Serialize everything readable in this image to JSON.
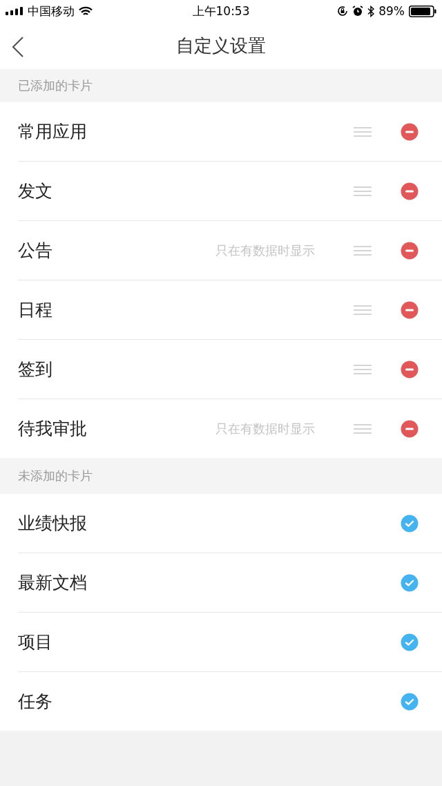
{
  "status_bar": {
    "carrier": "中国移动",
    "time": "上午10:53",
    "battery": "89%"
  },
  "nav": {
    "title": "自定义设置"
  },
  "sections": [
    {
      "kind": "added",
      "header": "已添加的卡片",
      "rows": [
        {
          "label": "常用应用"
        },
        {
          "label": "发文"
        },
        {
          "label": "公告",
          "hint": "只在有数据时显示"
        },
        {
          "label": "日程"
        },
        {
          "label": "签到"
        },
        {
          "label": "待我审批",
          "hint": "只在有数据时显示"
        }
      ]
    },
    {
      "kind": "available",
      "header": "未添加的卡片",
      "rows": [
        {
          "label": "业绩快报"
        },
        {
          "label": "最新文档"
        },
        {
          "label": "项目"
        },
        {
          "label": "任务"
        }
      ]
    }
  ]
}
